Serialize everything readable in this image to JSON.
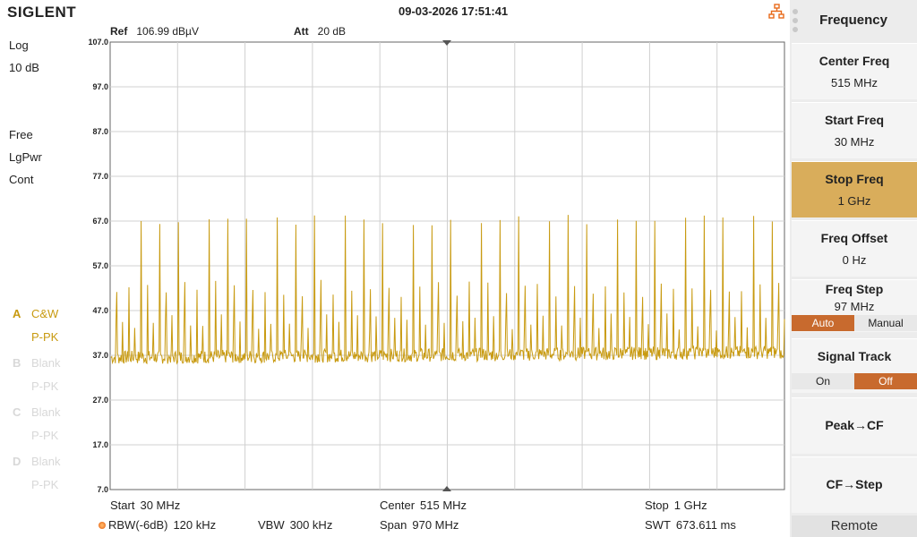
{
  "header": {
    "brand": "SIGLENT",
    "datetime": "09-03-2026 17:51:41",
    "network_icon": "network-icon"
  },
  "status": {
    "scale_type": "Log",
    "scale_div": "10 dB",
    "trigger": "Free",
    "detector": "LgPwr",
    "sweep_mode": "Cont"
  },
  "traces": [
    {
      "letter": "A",
      "type": "C&W",
      "detector": "P-PK",
      "active": true
    },
    {
      "letter": "B",
      "type": "Blank",
      "detector": "P-PK",
      "active": false
    },
    {
      "letter": "C",
      "type": "Blank",
      "detector": "P-PK",
      "active": false
    },
    {
      "letter": "D",
      "type": "Blank",
      "detector": "P-PK",
      "active": false
    }
  ],
  "ref": {
    "label": "Ref",
    "value": "106.99 dBµV"
  },
  "att": {
    "label": "Att",
    "value": "20 dB"
  },
  "bottom": {
    "start_label": "Start",
    "start_value": "30 MHz",
    "center_label": "Center",
    "center_value": "515 MHz",
    "stop_label": "Stop",
    "stop_value": "1 GHz",
    "rbw_label": "RBW(-6dB)",
    "rbw_value": "120 kHz",
    "vbw_label": "VBW",
    "vbw_value": "300 kHz",
    "span_label": "Span",
    "span_value": "970 MHz",
    "swt_label": "SWT",
    "swt_value": "673.611 ms"
  },
  "menu": {
    "title": "Frequency",
    "items": [
      {
        "label": "Center Freq",
        "value": "515 MHz"
      },
      {
        "label": "Start Freq",
        "value": "30 MHz"
      },
      {
        "label": "Stop Freq",
        "value": "1 GHz"
      },
      {
        "label": "Freq Offset",
        "value": "0 Hz"
      },
      {
        "label": "Freq Step",
        "value": "97 MHz",
        "opt_a": "Auto",
        "opt_b": "Manual"
      },
      {
        "label": "Signal Track",
        "opt_a": "On",
        "opt_b": "Off"
      },
      {
        "label": "Peak→CF"
      },
      {
        "label": "CF→Step"
      }
    ],
    "remote": "Remote"
  },
  "chart_data": {
    "type": "line",
    "x_unit": "MHz",
    "x_range": [
      30,
      1000
    ],
    "y_unit": "dBµV",
    "ylim": [
      7.0,
      107.0
    ],
    "y_ticks": [
      "107.0",
      "97.0",
      "87.0",
      "77.0",
      "67.0",
      "57.0",
      "47.0",
      "37.0",
      "27.0",
      "17.0",
      "7.0"
    ],
    "grid": true,
    "trace_color": "#c89a10",
    "series": [
      {
        "noise_floor_dbuv": 36.5,
        "spike_spacing_mhz": 8.9,
        "spike_peak_dbuv": 68.5,
        "spike_mid_dbuv": 52.0
      }
    ]
  }
}
